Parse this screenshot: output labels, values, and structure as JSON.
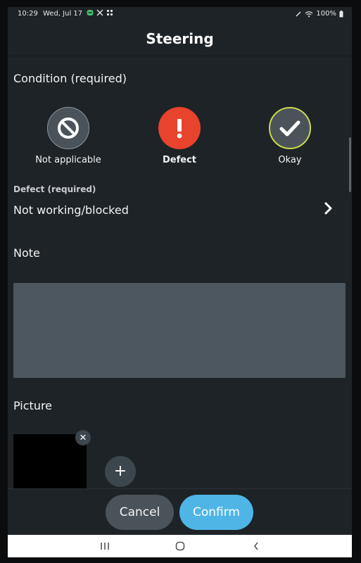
{
  "status_bar": {
    "time": "10:29",
    "date": "Wed, Jul 17",
    "battery": "100%"
  },
  "header": {
    "title": "Steering"
  },
  "condition": {
    "label": "Condition (required)",
    "options": [
      {
        "label": "Not applicable",
        "icon": "block-icon",
        "color": "#4a5359",
        "selected": false
      },
      {
        "label": "Defect",
        "icon": "exclamation-icon",
        "color": "#e8432c",
        "selected": true
      },
      {
        "label": "Okay",
        "icon": "check-icon",
        "color": "#4a5359",
        "border": "#c9d94a",
        "selected": false
      }
    ]
  },
  "defect": {
    "label": "Defect (required)",
    "value": "Not working/blocked"
  },
  "note": {
    "label": "Note",
    "value": ""
  },
  "picture": {
    "label": "Picture"
  },
  "actions": {
    "cancel": "Cancel",
    "confirm": "Confirm"
  },
  "colors": {
    "background": "#1e2327",
    "confirm": "#4fb5e6",
    "defect": "#e8432c",
    "note_box": "#4c575f"
  }
}
